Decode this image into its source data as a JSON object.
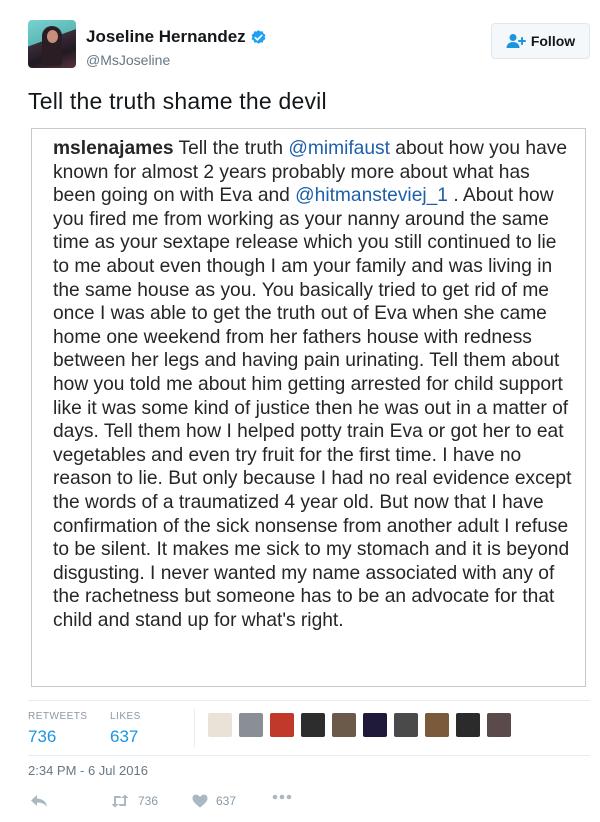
{
  "author": {
    "display_name": "Joseline Hernandez",
    "handle": "@MsJoseline",
    "verified": true
  },
  "follow_label": "Follow",
  "tweet_text": "Tell the truth shame the devil",
  "embedded_image": {
    "username": "mslenajames",
    "caption_parts": [
      " Tell the truth ",
      "@mimifaust",
      " about how you have known for almost 2 years probably more about what has been going on with Eva and ",
      "@hitmansteviej_1",
      " . About how you fired me from working as your nanny around the same time as your sextape release which you still continued to lie to me about even though I am your family and was living in the same house as you. You basically tried to get rid of me once I was able to get the truth out of Eva when she came home one weekend from her fathers house with redness between her legs and having pain urinating. Tell them about how you told me about him getting arrested for child support like it was some kind of justice then he was out in a matter of days. Tell them how I helped potty train Eva or got her to eat vegetables and even try fruit for the first time. I have no reason to lie. But only because I had no real evidence except the words of a traumatized 4 year old. But now that I have confirmation of the sick nonsense from another adult I refuse to be silent. It makes me sick to my stomach and it is beyond disgusting. I never wanted my name associated with any of the rachetness but someone has to be an advocate for that child and stand up for what's right."
    ]
  },
  "stats": {
    "retweets_label": "RETWEETS",
    "retweets": "736",
    "likes_label": "LIKES",
    "likes": "637"
  },
  "liker_avatars": [
    "#e9e2d6",
    "#8a8f96",
    "#c0392b",
    "#2d2d2d",
    "#6b5a4a",
    "#1f1a3a",
    "#4a4a4a",
    "#7a5a3a",
    "#2b2b2b",
    "#5a4a4a"
  ],
  "timestamp": "2:34 PM - 6 Jul 2016",
  "actions": {
    "retweet_count": "736",
    "like_count": "637"
  },
  "colors": {
    "link": "#1b95e0",
    "verified": "#1da1f2",
    "muted": "#657786"
  }
}
